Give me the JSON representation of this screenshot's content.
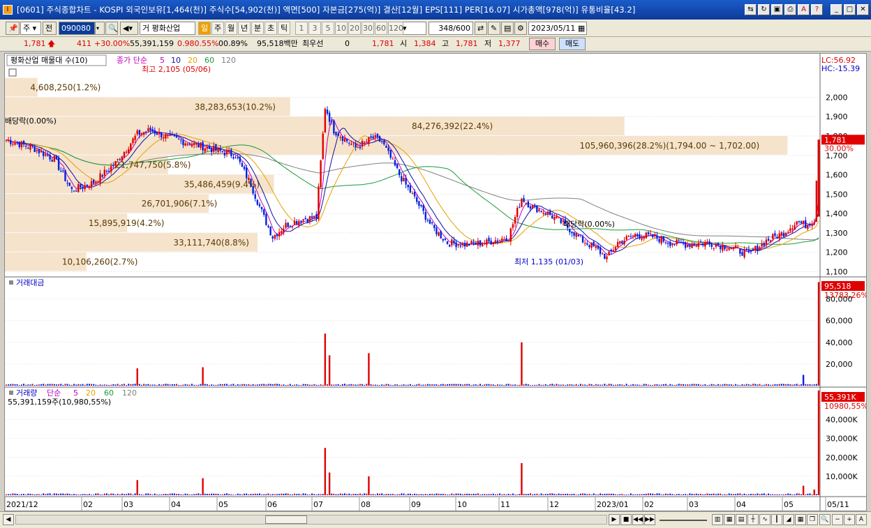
{
  "window": {
    "title": "[0601] 주식종합차트 - KOSPI 외국인보유[1,464(천)] 주식수[54,902(천)] 액면[500] 자본금[275(억)] 결산[12월] EPS[111] PER[16.07] 시가총액[978(억)] 유통비율[43.2]",
    "app_icon": "I"
  },
  "toolbar": {
    "market": "주",
    "prefix": "전",
    "code": "090080",
    "name": "평화산업",
    "name_prefix": "거",
    "periods": [
      "일",
      "주",
      "월",
      "년",
      "분",
      "초",
      "틱"
    ],
    "active_period": "일",
    "intervals": [
      "1",
      "3",
      "5",
      "10",
      "20",
      "30",
      "60",
      "120"
    ],
    "count": "348",
    "count_total": "/600",
    "date": "2023/05/11"
  },
  "quote": {
    "price": "1,781",
    "change": "411",
    "change_pct": "+30.00%",
    "volume": "55,391,159",
    "turnover_pct": "0.980.55%",
    "vol_ratio": "00.89%",
    "amount": "95,518백만",
    "pref_label": "최우선",
    "pref_value": "0",
    "ask": "1,781",
    "open_label": "시",
    "open": "1,384",
    "high_label": "고",
    "high": "1,781",
    "low_label": "저",
    "low": "1,377",
    "buy": "매수",
    "sell": "매도"
  },
  "panels": {
    "price": {
      "tab": "평화산업 매물대 수(10)",
      "ma_label": "종가 단순",
      "ma_periods": [
        "5",
        "10",
        "20",
        "60",
        "120"
      ],
      "lc": "LC:56.92",
      "hc": "HC:-15.39",
      "high_note": "최고 2,105 (05/06)",
      "low_note": "최저 1,135 (01/03)",
      "dividend1": "배당락(0.00%)",
      "dividend2": "배당락(0.00%)",
      "last_price": "1,781",
      "last_pct": "30.00%"
    },
    "amount": {
      "title": "거래대금",
      "last": "95,518",
      "second": "13783,26%"
    },
    "volume": {
      "title": "거래량",
      "ma_label": "단순",
      "ma_periods": [
        "5",
        "20",
        "60",
        "120"
      ],
      "sub": "55,391,159주(10,980,55%)",
      "last": "55,391K",
      "second": "10980,55%"
    }
  },
  "volume_profile": [
    {
      "label": "4,608,250(1.2%)",
      "price": 2050,
      "frac": 0.04
    },
    {
      "label": "38,283,653(10.2%)",
      "price": 1950,
      "frac": 0.35
    },
    {
      "label": "84,276,392(22.4%)",
      "price": 1850,
      "frac": 0.76
    },
    {
      "label": "105,960,396(28.2%)(1,794.00 ~ 1,702.00)",
      "price": 1750,
      "frac": 0.96
    },
    {
      "label": "21,747,750(5.8%)",
      "price": 1650,
      "frac": 0.2
    },
    {
      "label": "35,486,459(9.4%)",
      "price": 1550,
      "frac": 0.33
    },
    {
      "label": "26,701,906(7.1%)",
      "price": 1450,
      "frac": 0.25
    },
    {
      "label": "15,895,919(4.2%)",
      "price": 1350,
      "frac": 0.15
    },
    {
      "label": "33,111,740(8.8%)",
      "price": 1250,
      "frac": 0.31
    },
    {
      "label": "10,106,260(2.7%)",
      "price": 1150,
      "frac": 0.1
    }
  ],
  "axes": {
    "price_ticks": [
      "2,000",
      "1,900",
      "1,800",
      "1,700",
      "1,600",
      "1,500",
      "1,400",
      "1,300",
      "1,200",
      "1,100"
    ],
    "amount_ticks": [
      "80,000",
      "60,000",
      "40,000",
      "20,000"
    ],
    "volume_ticks": [
      "40,000K",
      "30,000K",
      "20,000K",
      "10,000K"
    ],
    "x_ticks": [
      "2021/12",
      "02",
      "03",
      "04",
      "05",
      "06",
      "07",
      "08",
      "09",
      "10",
      "11",
      "12",
      "2023/01",
      "02",
      "03",
      "04",
      "05",
      "05/11"
    ]
  },
  "chart_data": {
    "type": "line",
    "title": "평화산업 090080 일봉",
    "price_range": [
      1080,
      2160
    ],
    "close_anchors": [
      [
        0,
        1780
      ],
      [
        12,
        1740
      ],
      [
        22,
        1680
      ],
      [
        30,
        1520
      ],
      [
        40,
        1560
      ],
      [
        50,
        1660
      ],
      [
        60,
        1810
      ],
      [
        66,
        1830
      ],
      [
        75,
        1790
      ],
      [
        85,
        1760
      ],
      [
        95,
        1730
      ],
      [
        105,
        1700
      ],
      [
        112,
        1550
      ],
      [
        118,
        1380
      ],
      [
        122,
        1280
      ],
      [
        128,
        1340
      ],
      [
        135,
        1370
      ],
      [
        142,
        1380
      ],
      [
        146,
        1950
      ],
      [
        150,
        1830
      ],
      [
        160,
        1740
      ],
      [
        168,
        1790
      ],
      [
        172,
        1770
      ],
      [
        180,
        1600
      ],
      [
        188,
        1460
      ],
      [
        195,
        1330
      ],
      [
        202,
        1250
      ],
      [
        210,
        1240
      ],
      [
        220,
        1250
      ],
      [
        230,
        1280
      ],
      [
        236,
        1480
      ],
      [
        240,
        1440
      ],
      [
        248,
        1400
      ],
      [
        256,
        1340
      ],
      [
        264,
        1260
      ],
      [
        270,
        1220
      ],
      [
        275,
        1170
      ],
      [
        280,
        1250
      ],
      [
        288,
        1290
      ],
      [
        296,
        1280
      ],
      [
        304,
        1250
      ],
      [
        312,
        1240
      ],
      [
        320,
        1250
      ],
      [
        330,
        1230
      ],
      [
        340,
        1190
      ],
      [
        348,
        1260
      ],
      [
        356,
        1300
      ],
      [
        362,
        1360
      ],
      [
        366,
        1340
      ],
      [
        370,
        1370
      ],
      [
        372,
        1781
      ]
    ],
    "volume_spikes_k": [
      [
        60,
        8000
      ],
      [
        90,
        9000
      ],
      [
        146,
        25000
      ],
      [
        148,
        12000
      ],
      [
        166,
        10000
      ],
      [
        236,
        17000
      ],
      [
        365,
        5000
      ],
      [
        370,
        3000
      ],
      [
        372,
        55391
      ]
    ],
    "amount_spikes": [
      [
        60,
        16000
      ],
      [
        90,
        17000
      ],
      [
        146,
        48000
      ],
      [
        148,
        28000
      ],
      [
        166,
        30000
      ],
      [
        236,
        40000
      ],
      [
        365,
        10000
      ],
      [
        372,
        95518
      ]
    ]
  }
}
